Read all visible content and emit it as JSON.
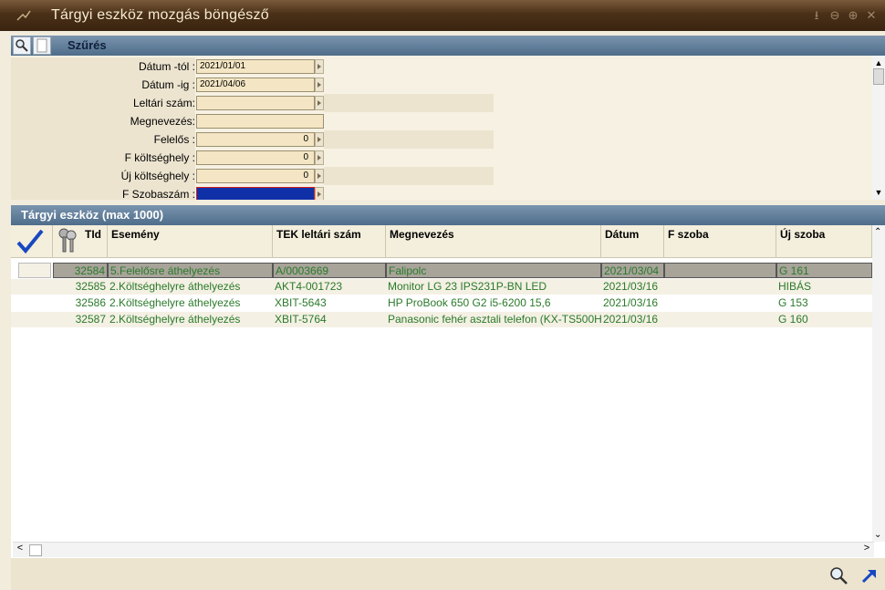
{
  "window": {
    "title": "Tárgyi eszköz mozgás böngésző"
  },
  "filter": {
    "header": "Szűrés",
    "rows": [
      {
        "label": "Dátum -tól :",
        "value": "2021/01/01"
      },
      {
        "label": "Dátum -ig :",
        "value": "2021/04/06"
      },
      {
        "label": "Leltári szám:",
        "value": ""
      },
      {
        "label": "Megnevezés:",
        "value": ""
      },
      {
        "label": "Felelős :",
        "value": "0"
      },
      {
        "label": "F költséghely :",
        "value": "0"
      },
      {
        "label": "Új költséghely :",
        "value": "0"
      },
      {
        "label": "F Szobaszám :",
        "value": ""
      }
    ]
  },
  "grid": {
    "header": "Tárgyi eszköz (max 1000)",
    "columns": [
      "TId",
      "Esemény",
      "TEK leltári szám",
      "Megnevezés",
      "Dátum",
      "F szoba",
      "Új szoba"
    ],
    "rows": [
      {
        "tid": "32584",
        "esemeny": "5.Felelősre áthelyezés",
        "tek": "A/0003669",
        "megnevezes": "Falipolc",
        "datum": "2021/03/04",
        "fszoba": "",
        "ujszoba": "G 161"
      },
      {
        "tid": "32585",
        "esemeny": "2.Költséghelyre áthelyezés",
        "tek": "AKT4-001723",
        "megnevezes": "Monitor LG 23 IPS231P-BN LED",
        "datum": "2021/03/16",
        "fszoba": "",
        "ujszoba": "HIBÁS"
      },
      {
        "tid": "32586",
        "esemeny": "2.Költséghelyre áthelyezés",
        "tek": "XBIT-5643",
        "megnevezes": "HP ProBook 650 G2 i5-6200 15,6",
        "datum": "2021/03/16",
        "fszoba": "",
        "ujszoba": "G 153"
      },
      {
        "tid": "32587",
        "esemeny": "2.Költséghelyre áthelyezés",
        "tek": "XBIT-5764",
        "megnevezes": "Panasonic fehér asztali telefon (KX-TS500H",
        "datum": "2021/03/16",
        "fszoba": "",
        "ujszoba": "G 160"
      }
    ]
  },
  "colors": {
    "accent": "#4e6d8a",
    "title_bg": "#4a3018",
    "row_text": "#2a7a2a"
  }
}
